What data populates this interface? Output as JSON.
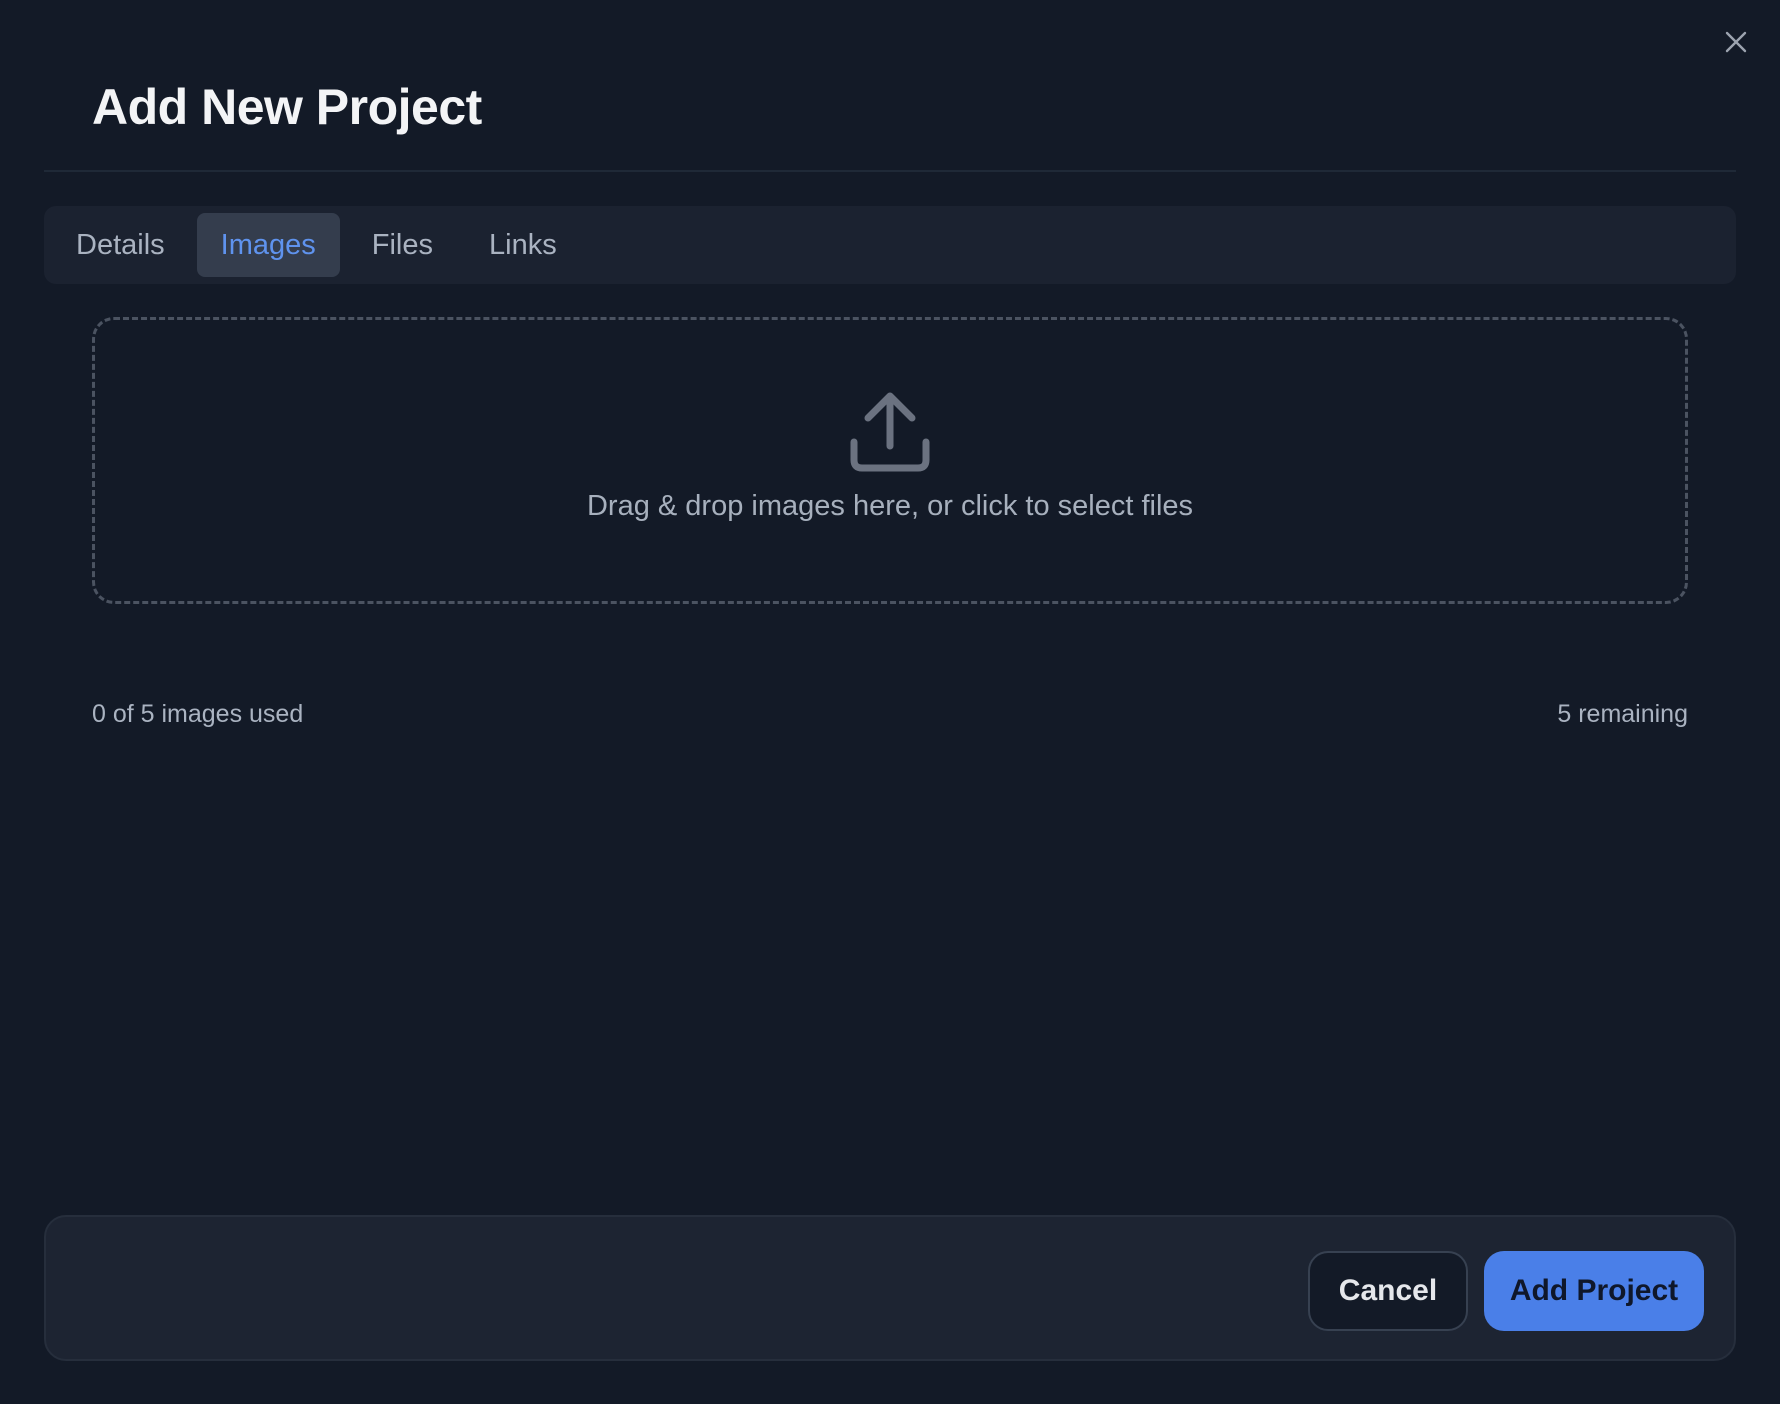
{
  "dialog": {
    "title": "Add New Project",
    "close_icon": "close-icon"
  },
  "tabs": [
    {
      "label": "Details",
      "active": false
    },
    {
      "label": "Images",
      "active": true
    },
    {
      "label": "Files",
      "active": false
    },
    {
      "label": "Links",
      "active": false
    }
  ],
  "dropzone": {
    "icon": "upload-icon",
    "text": "Drag & drop images here, or click to select files"
  },
  "usage": {
    "used_text": "0 of 5 images used",
    "remaining_text": "5 remaining"
  },
  "footer": {
    "cancel_label": "Cancel",
    "submit_label": "Add Project"
  },
  "colors": {
    "background": "#131a27",
    "accent": "#4a7fe8",
    "active_tab_text": "#5f93ee"
  }
}
